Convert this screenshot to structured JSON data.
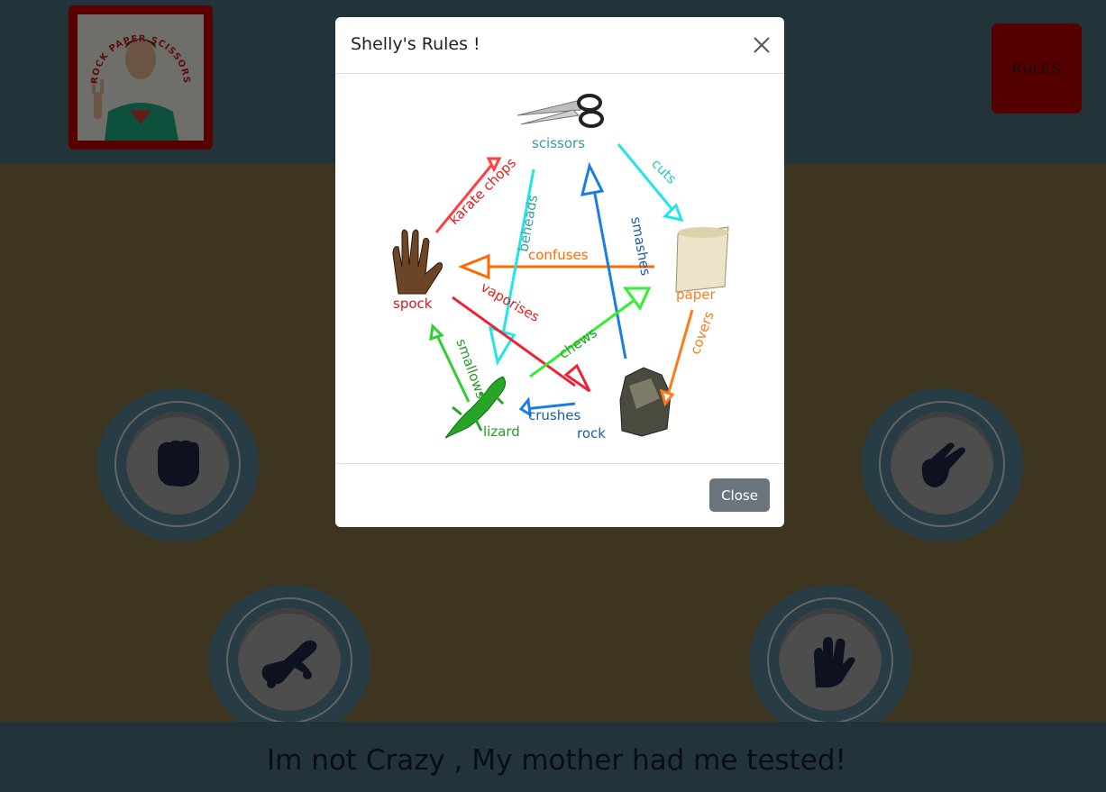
{
  "header": {
    "logo_text": "ROCK PAPER SCISSORS",
    "rules_label": "RULES"
  },
  "choices": [
    {
      "name": "rock",
      "icon": "fist-icon"
    },
    {
      "name": "paper",
      "icon": "paper-icon"
    },
    {
      "name": "scissors",
      "icon": "scissors-hand-icon"
    },
    {
      "name": "lizard",
      "icon": "lizard-icon"
    },
    {
      "name": "spock",
      "icon": "spock-hand-icon"
    }
  ],
  "footer": {
    "tagline": "Im not Crazy , My mother had me tested!"
  },
  "modal": {
    "title": "Shelly's Rules !",
    "close_label": "Close",
    "diagram": {
      "labels": {
        "scissors": "scissors",
        "paper": "paper",
        "rock": "rock",
        "lizard": "lizard",
        "spock": "spock"
      },
      "verbs": {
        "cuts": "cuts",
        "covers": "covers",
        "crushes": "crushes",
        "smallows": "smallows",
        "karate_chops": "karate chops",
        "confuses": "confuses",
        "smashes": "smashes",
        "beheads": "beheads",
        "vaporises": "vaporises",
        "chews": "chews"
      }
    }
  },
  "colors": {
    "header_bg": "#466675",
    "board_bg": "#7c6b43",
    "rules_bg": "#a80000",
    "button_ring": "#4e7889"
  }
}
